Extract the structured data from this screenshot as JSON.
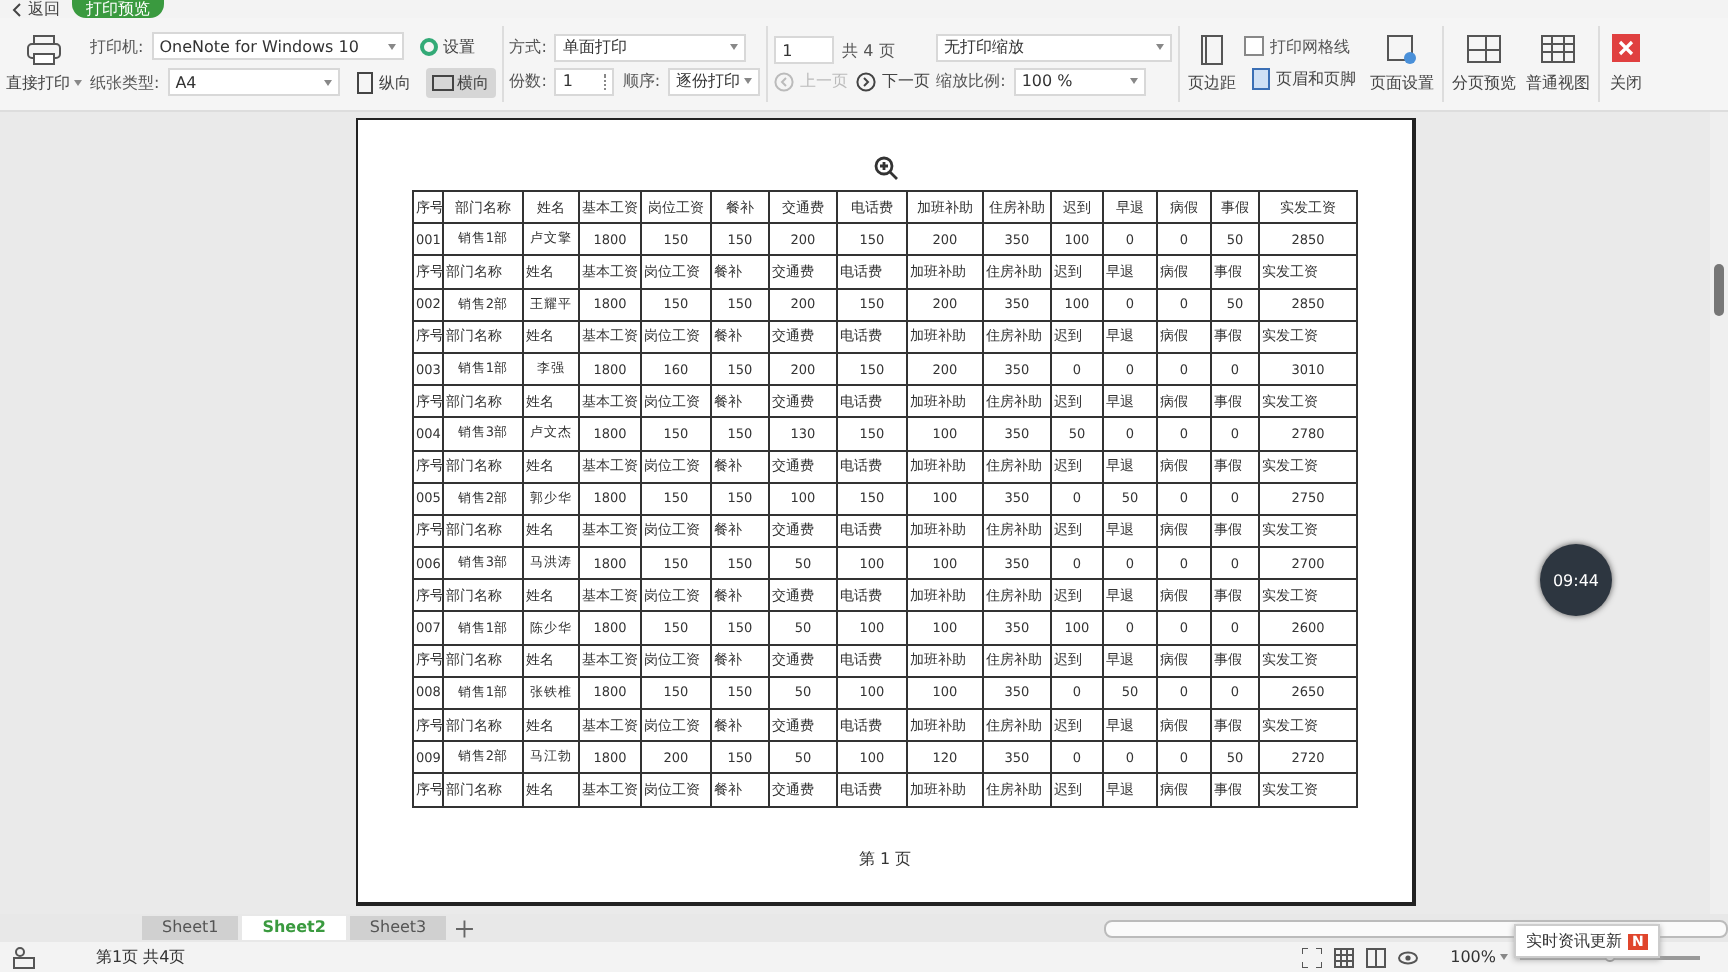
{
  "top": {
    "back": "返回",
    "mode_tab": "打印预览"
  },
  "toolbar": {
    "print_button": "直接打印",
    "printer": {
      "label": "打印机:",
      "value": "OneNote for Windows 10"
    },
    "paper": {
      "label": "纸张类型:",
      "value": "A4"
    },
    "settings": "设置",
    "orientation": [
      {
        "label": "纵向",
        "selected": false
      },
      {
        "label": "横向",
        "selected": true
      }
    ],
    "method": {
      "label": "方式:",
      "value": "单面打印"
    },
    "copies": {
      "label": "份数:",
      "value": "1"
    },
    "order": {
      "label": "顺序:",
      "value": "逐份打印"
    },
    "page_input": "1",
    "page_total": "共 4 页",
    "prev": {
      "label": "上一页",
      "disabled": true
    },
    "next": {
      "label": "下一页",
      "disabled": false
    },
    "scaling": "无打印缩放",
    "zoom": {
      "label": "缩放比例:",
      "value": "100 %"
    },
    "margins": "页边距",
    "gridlines": {
      "label": "打印网格线",
      "checked": false
    },
    "header_footer": "页眉和页脚",
    "page_setup": "页面设置",
    "page_break": "分页预览",
    "normal_view": "普通视图",
    "close": "关闭"
  },
  "page": {
    "table": {
      "rows": [
        {
          "kind": "title_header",
          "cells": [
            "序号",
            "部门名称",
            "姓名",
            "基本工资",
            "岗位工资",
            "餐补",
            "交通费",
            "电话费",
            "加班补助",
            "住房补助",
            "迟到",
            "早退",
            "病假",
            "事假",
            "实发工资"
          ]
        },
        {
          "kind": "data",
          "cells": [
            "001",
            "销售1部",
            "卢文擎",
            "1800",
            "150",
            "150",
            "200",
            "150",
            "200",
            "350",
            "100",
            "0",
            "0",
            "50",
            "2850"
          ]
        },
        {
          "kind": "header",
          "cells": [
            "序号",
            "部门名称",
            "姓名",
            "基本工资",
            "岗位工资",
            "餐补",
            "交通费",
            "电话费",
            "加班补助",
            "住房补助",
            "迟到",
            "早退",
            "病假",
            "事假",
            "实发工资"
          ]
        },
        {
          "kind": "data",
          "cells": [
            "002",
            "销售2部",
            "王耀平",
            "1800",
            "150",
            "150",
            "200",
            "150",
            "200",
            "350",
            "100",
            "0",
            "0",
            "50",
            "2850"
          ]
        },
        {
          "kind": "header",
          "cells": [
            "序号",
            "部门名称",
            "姓名",
            "基本工资",
            "岗位工资",
            "餐补",
            "交通费",
            "电话费",
            "加班补助",
            "住房补助",
            "迟到",
            "早退",
            "病假",
            "事假",
            "实发工资"
          ]
        },
        {
          "kind": "data",
          "cells": [
            "003",
            "销售1部",
            "李强",
            "1800",
            "160",
            "150",
            "200",
            "150",
            "200",
            "350",
            "0",
            "0",
            "0",
            "0",
            "3010"
          ]
        },
        {
          "kind": "header",
          "cells": [
            "序号",
            "部门名称",
            "姓名",
            "基本工资",
            "岗位工资",
            "餐补",
            "交通费",
            "电话费",
            "加班补助",
            "住房补助",
            "迟到",
            "早退",
            "病假",
            "事假",
            "实发工资"
          ]
        },
        {
          "kind": "data",
          "cells": [
            "004",
            "销售3部",
            "卢文杰",
            "1800",
            "150",
            "150",
            "130",
            "150",
            "100",
            "350",
            "50",
            "0",
            "0",
            "0",
            "2780"
          ]
        },
        {
          "kind": "header",
          "cells": [
            "序号",
            "部门名称",
            "姓名",
            "基本工资",
            "岗位工资",
            "餐补",
            "交通费",
            "电话费",
            "加班补助",
            "住房补助",
            "迟到",
            "早退",
            "病假",
            "事假",
            "实发工资"
          ]
        },
        {
          "kind": "data",
          "cells": [
            "005",
            "销售2部",
            "郭少华",
            "1800",
            "150",
            "150",
            "100",
            "150",
            "100",
            "350",
            "0",
            "50",
            "0",
            "0",
            "2750"
          ]
        },
        {
          "kind": "header",
          "cells": [
            "序号",
            "部门名称",
            "姓名",
            "基本工资",
            "岗位工资",
            "餐补",
            "交通费",
            "电话费",
            "加班补助",
            "住房补助",
            "迟到",
            "早退",
            "病假",
            "事假",
            "实发工资"
          ]
        },
        {
          "kind": "data",
          "cells": [
            "006",
            "销售3部",
            "马洪涛",
            "1800",
            "150",
            "150",
            "50",
            "100",
            "100",
            "350",
            "0",
            "0",
            "0",
            "0",
            "2700"
          ]
        },
        {
          "kind": "header",
          "cells": [
            "序号",
            "部门名称",
            "姓名",
            "基本工资",
            "岗位工资",
            "餐补",
            "交通费",
            "电话费",
            "加班补助",
            "住房补助",
            "迟到",
            "早退",
            "病假",
            "事假",
            "实发工资"
          ]
        },
        {
          "kind": "data",
          "cells": [
            "007",
            "销售1部",
            "陈少华",
            "1800",
            "150",
            "150",
            "50",
            "100",
            "100",
            "350",
            "100",
            "0",
            "0",
            "0",
            "2600"
          ]
        },
        {
          "kind": "header",
          "cells": [
            "序号",
            "部门名称",
            "姓名",
            "基本工资",
            "岗位工资",
            "餐补",
            "交通费",
            "电话费",
            "加班补助",
            "住房补助",
            "迟到",
            "早退",
            "病假",
            "事假",
            "实发工资"
          ]
        },
        {
          "kind": "data",
          "cells": [
            "008",
            "销售1部",
            "张铁椎",
            "1800",
            "150",
            "150",
            "50",
            "100",
            "100",
            "350",
            "0",
            "50",
            "0",
            "0",
            "2650"
          ]
        },
        {
          "kind": "header",
          "cells": [
            "序号",
            "部门名称",
            "姓名",
            "基本工资",
            "岗位工资",
            "餐补",
            "交通费",
            "电话费",
            "加班补助",
            "住房补助",
            "迟到",
            "早退",
            "病假",
            "事假",
            "实发工资"
          ]
        },
        {
          "kind": "data",
          "cells": [
            "009",
            "销售2部",
            "马江勃",
            "1800",
            "200",
            "150",
            "50",
            "100",
            "120",
            "350",
            "0",
            "0",
            "0",
            "50",
            "2720"
          ]
        },
        {
          "kind": "header",
          "cells": [
            "序号",
            "部门名称",
            "姓名",
            "基本工资",
            "岗位工资",
            "餐补",
            "交通费",
            "电话费",
            "加班补助",
            "住房补助",
            "迟到",
            "早退",
            "病假",
            "事假",
            "实发工资"
          ]
        }
      ]
    },
    "footer": "第 1 页"
  },
  "clock": "09:44",
  "sheet_tabs": [
    {
      "label": "Sheet1",
      "selected": false
    },
    {
      "label": "Sheet2",
      "selected": true
    },
    {
      "label": "Sheet3",
      "selected": false
    }
  ],
  "status_bar": {
    "page_info": "第1页 共4页",
    "zoom": "100%",
    "zoom_slider": {
      "level": 0.5
    },
    "notification": "实时资讯更新",
    "badge": "N"
  }
}
